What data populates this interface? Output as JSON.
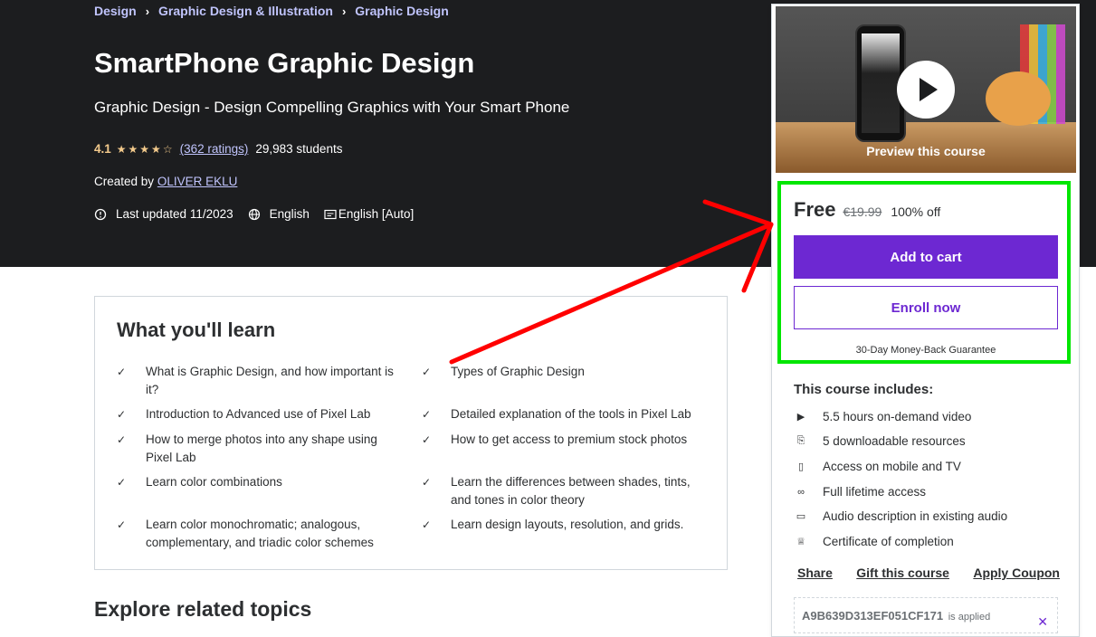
{
  "breadcrumb": [
    "Design",
    "Graphic Design & Illustration",
    "Graphic Design"
  ],
  "course": {
    "title": "SmartPhone Graphic Design",
    "subtitle": "Graphic Design - Design Compelling Graphics with Your Smart Phone",
    "rating": "4.1",
    "stars": 4.1,
    "ratings_text": "(362 ratings)",
    "students": "29,983 students",
    "created_by_label": "Created by",
    "author": "OLIVER EKLU",
    "last_updated": "Last updated 11/2023",
    "language": "English",
    "captions": "English [Auto]"
  },
  "learn": {
    "title": "What you'll learn",
    "items": [
      "What is Graphic Design, and how important is it?",
      "Types of Graphic Design",
      "Introduction to Advanced use of Pixel Lab",
      "Detailed explanation of the tools in Pixel Lab",
      "How to merge photos into any shape using Pixel Lab",
      "How to get access to premium stock photos",
      "Learn color combinations",
      "Learn the differences between shades, tints, and tones in color theory",
      "Learn color monochromatic; analogous, complementary, and triadic color schemes",
      "Learn design layouts, resolution, and grids."
    ]
  },
  "explore_title": "Explore related topics",
  "sidebar": {
    "preview_label": "Preview this course",
    "price": "Free",
    "original_price": "€19.99",
    "discount": "100% off",
    "add_to_cart": "Add to cart",
    "enroll": "Enroll now",
    "guarantee": "30-Day Money-Back Guarantee",
    "includes_title": "This course includes:",
    "includes": [
      {
        "icon": "video-icon",
        "text": "5.5 hours on-demand video"
      },
      {
        "icon": "download-file-icon",
        "text": "5 downloadable resources"
      },
      {
        "icon": "mobile-icon",
        "text": "Access on mobile and TV"
      },
      {
        "icon": "infinity-icon",
        "text": "Full lifetime access"
      },
      {
        "icon": "audio-description-icon",
        "text": "Audio description in existing audio"
      },
      {
        "icon": "trophy-icon",
        "text": "Certificate of completion"
      }
    ],
    "links": [
      "Share",
      "Gift this course",
      "Apply Coupon"
    ],
    "coupon_code": "A9B639D313EF051CF171",
    "coupon_applied": "is applied"
  },
  "colors": {
    "hero_bg": "#1c1d1f",
    "link": "#c0c4fc",
    "purple": "#6d28d2",
    "annotation_arrow": "#ff0000",
    "annotation_box": "#00e600"
  }
}
